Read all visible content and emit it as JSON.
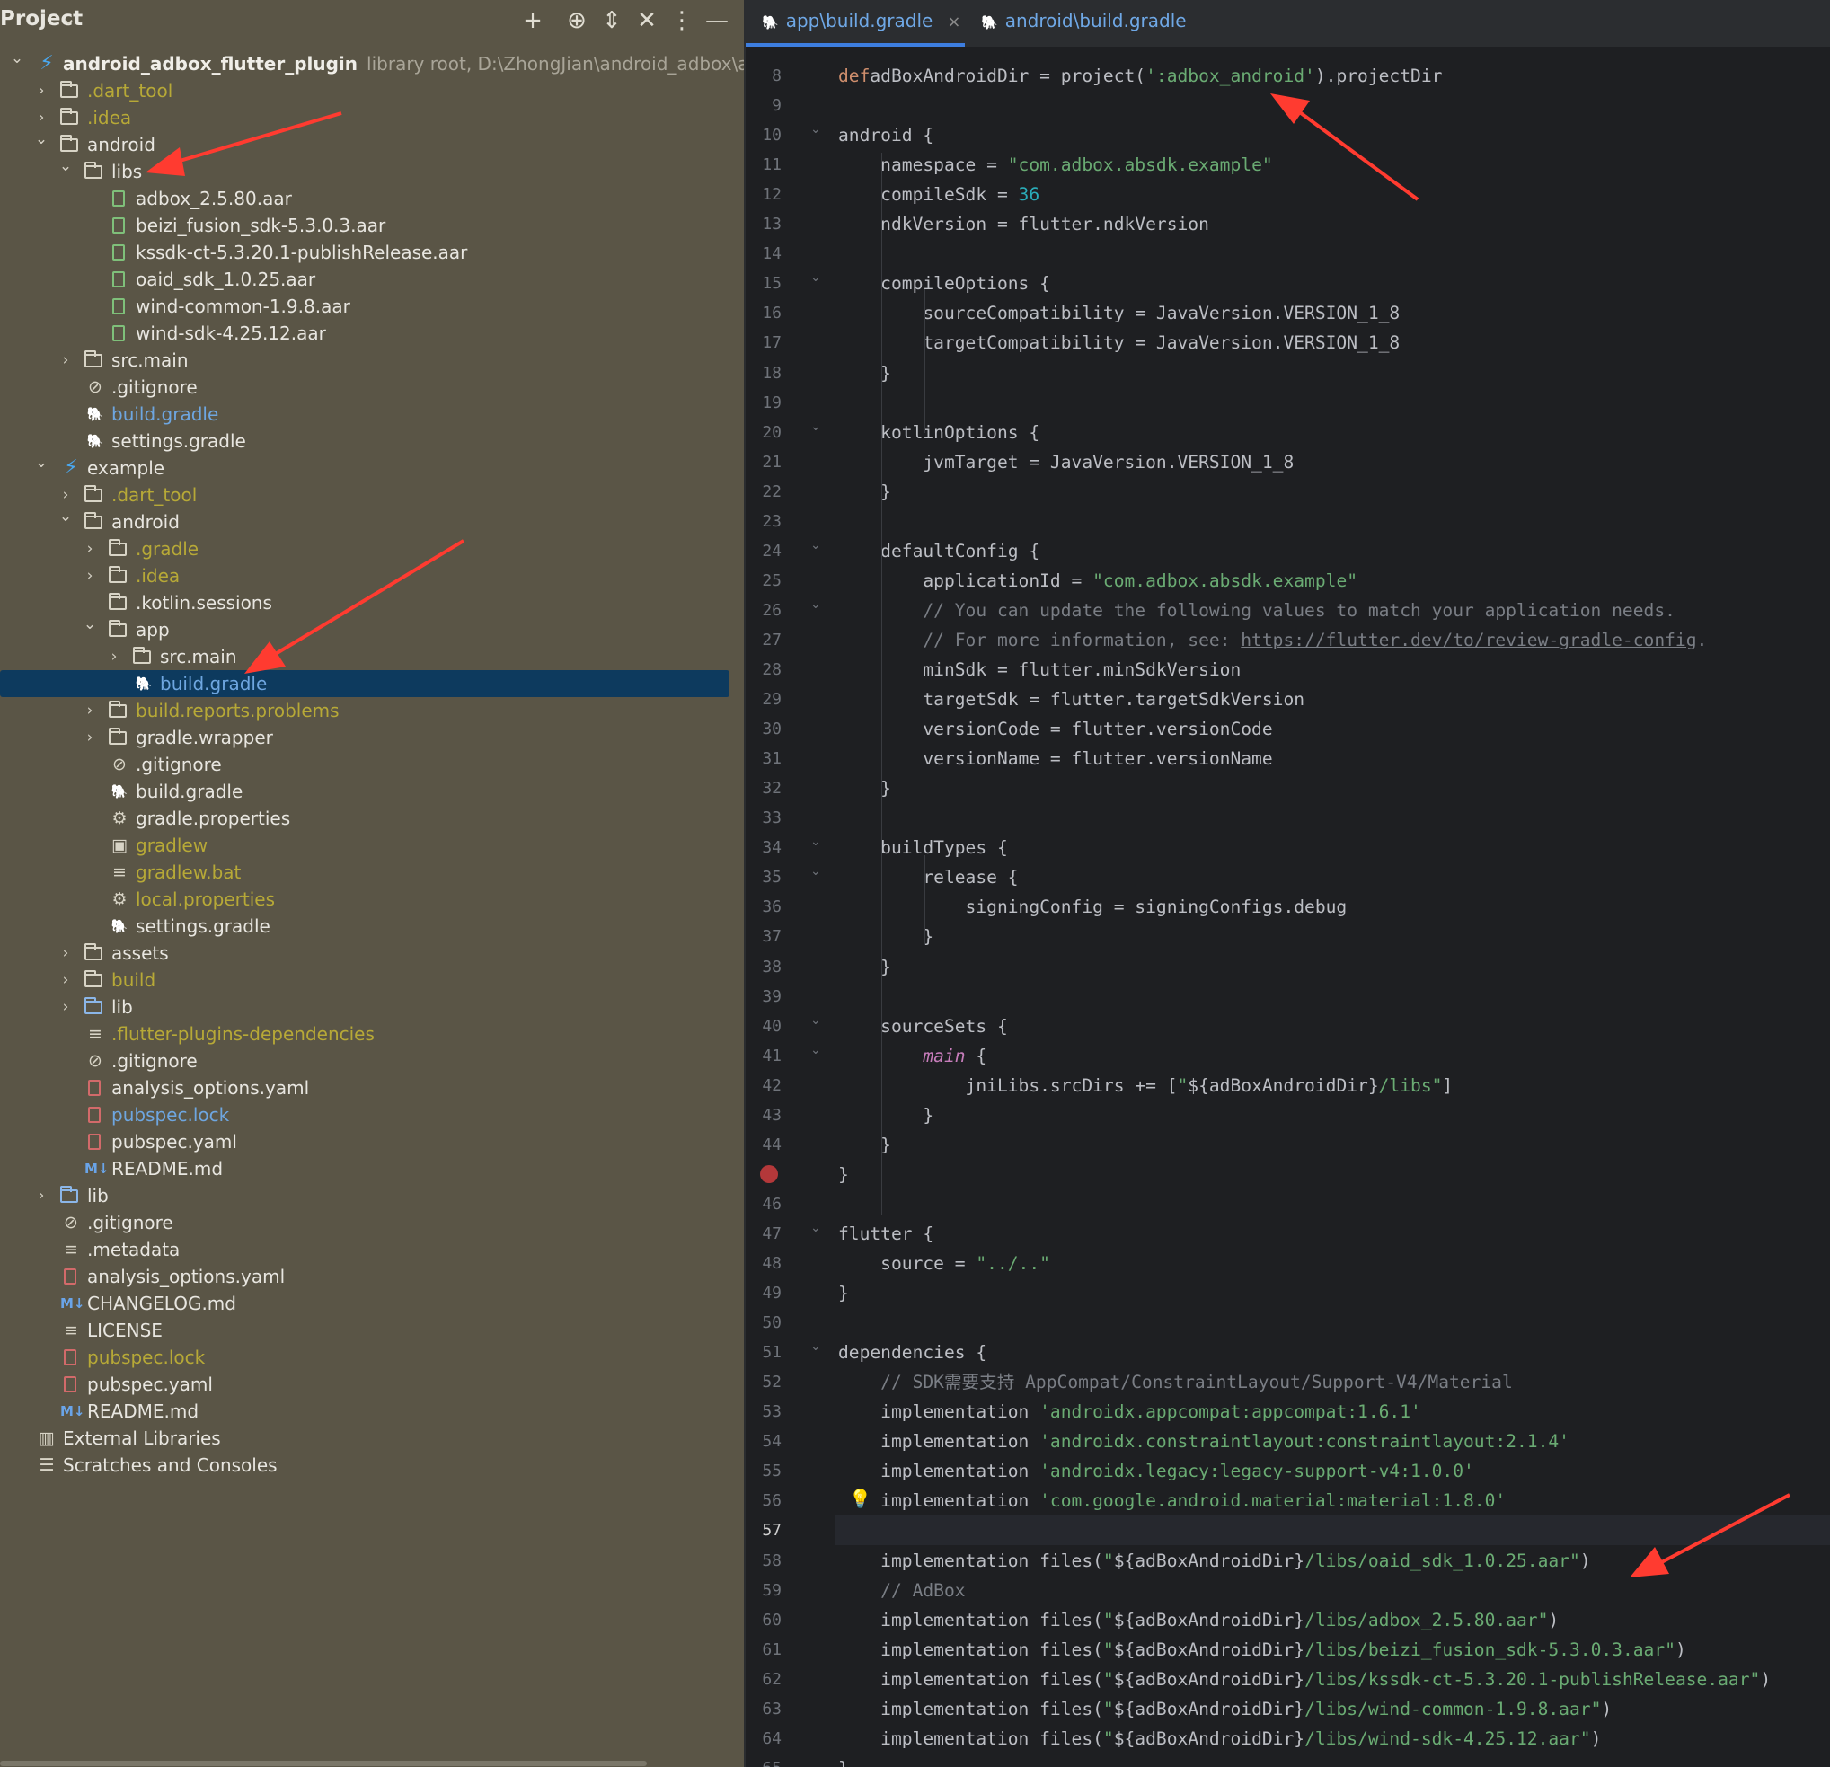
{
  "project_panel": {
    "title": "Project",
    "tree": [
      {
        "depth": 0,
        "toggle": "v",
        "icon": "flutter",
        "label": "android_adbox_flutter_plugin",
        "style": "bold",
        "meta": "library root,  D:\\ZhongJian\\android_adbox\\android_adbox_f"
      },
      {
        "depth": 1,
        "toggle": ">",
        "icon": "folder",
        "label": ".dart_tool",
        "style": "ignored"
      },
      {
        "depth": 1,
        "toggle": ">",
        "icon": "folder",
        "label": ".idea",
        "style": "ignored"
      },
      {
        "depth": 1,
        "toggle": "v",
        "icon": "folder",
        "label": "android",
        "style": ""
      },
      {
        "depth": 2,
        "toggle": "v",
        "icon": "folder",
        "label": "libs",
        "style": ""
      },
      {
        "depth": 3,
        "toggle": "",
        "icon": "file-green",
        "label": "adbox_2.5.80.aar",
        "style": ""
      },
      {
        "depth": 3,
        "toggle": "",
        "icon": "file-green",
        "label": "beizi_fusion_sdk-5.3.0.3.aar",
        "style": ""
      },
      {
        "depth": 3,
        "toggle": "",
        "icon": "file-green",
        "label": "kssdk-ct-5.3.20.1-publishRelease.aar",
        "style": ""
      },
      {
        "depth": 3,
        "toggle": "",
        "icon": "file-green",
        "label": "oaid_sdk_1.0.25.aar",
        "style": ""
      },
      {
        "depth": 3,
        "toggle": "",
        "icon": "file-green",
        "label": "wind-common-1.9.8.aar",
        "style": ""
      },
      {
        "depth": 3,
        "toggle": "",
        "icon": "file-green",
        "label": "wind-sdk-4.25.12.aar",
        "style": ""
      },
      {
        "depth": 2,
        "toggle": ">",
        "icon": "folder",
        "label": "src.main",
        "style": ""
      },
      {
        "depth": 2,
        "toggle": "",
        "icon": "gitignore",
        "label": ".gitignore",
        "style": ""
      },
      {
        "depth": 2,
        "toggle": "",
        "icon": "gradle",
        "label": "build.gradle",
        "style": "blue"
      },
      {
        "depth": 2,
        "toggle": "",
        "icon": "gradle",
        "label": "settings.gradle",
        "style": ""
      },
      {
        "depth": 1,
        "toggle": "v",
        "icon": "flutter",
        "label": "example",
        "style": ""
      },
      {
        "depth": 2,
        "toggle": ">",
        "icon": "folder",
        "label": ".dart_tool",
        "style": "ignored"
      },
      {
        "depth": 2,
        "toggle": "v",
        "icon": "folder",
        "label": "android",
        "style": ""
      },
      {
        "depth": 3,
        "toggle": ">",
        "icon": "folder",
        "label": ".gradle",
        "style": "ignored"
      },
      {
        "depth": 3,
        "toggle": ">",
        "icon": "folder",
        "label": ".idea",
        "style": "ignored"
      },
      {
        "depth": 3,
        "toggle": "",
        "icon": "folder",
        "label": ".kotlin.sessions",
        "style": ""
      },
      {
        "depth": 3,
        "toggle": "v",
        "icon": "folder",
        "label": "app",
        "style": ""
      },
      {
        "depth": 4,
        "toggle": ">",
        "icon": "folder",
        "label": "src.main",
        "style": ""
      },
      {
        "depth": 4,
        "toggle": "",
        "icon": "gradle",
        "label": "build.gradle",
        "style": "blue",
        "selected": true
      },
      {
        "depth": 3,
        "toggle": ">",
        "icon": "folder",
        "label": "build.reports.problems",
        "style": "ignored"
      },
      {
        "depth": 3,
        "toggle": ">",
        "icon": "folder",
        "label": "gradle.wrapper",
        "style": ""
      },
      {
        "depth": 3,
        "toggle": "",
        "icon": "gitignore",
        "label": ".gitignore",
        "style": ""
      },
      {
        "depth": 3,
        "toggle": "",
        "icon": "gradle",
        "label": "build.gradle",
        "style": ""
      },
      {
        "depth": 3,
        "toggle": "",
        "icon": "gear",
        "label": "gradle.properties",
        "style": ""
      },
      {
        "depth": 3,
        "toggle": "",
        "icon": "terminal",
        "label": "gradlew",
        "style": "ignored"
      },
      {
        "depth": 3,
        "toggle": "",
        "icon": "lines",
        "label": "gradlew.bat",
        "style": "ignored"
      },
      {
        "depth": 3,
        "toggle": "",
        "icon": "gear",
        "label": "local.properties",
        "style": "ignored"
      },
      {
        "depth": 3,
        "toggle": "",
        "icon": "gradle",
        "label": "settings.gradle",
        "style": ""
      },
      {
        "depth": 2,
        "toggle": ">",
        "icon": "folder",
        "label": "assets",
        "style": ""
      },
      {
        "depth": 2,
        "toggle": ">",
        "icon": "folder",
        "label": "build",
        "style": "ignored"
      },
      {
        "depth": 2,
        "toggle": ">",
        "icon": "folder-blue",
        "label": "lib",
        "style": ""
      },
      {
        "depth": 2,
        "toggle": "",
        "icon": "lines",
        "label": ".flutter-plugins-dependencies",
        "style": "ignored"
      },
      {
        "depth": 2,
        "toggle": "",
        "icon": "gitignore",
        "label": ".gitignore",
        "style": ""
      },
      {
        "depth": 2,
        "toggle": "",
        "icon": "file-red",
        "label": "analysis_options.yaml",
        "style": ""
      },
      {
        "depth": 2,
        "toggle": "",
        "icon": "file-red",
        "label": "pubspec.lock",
        "style": "blue"
      },
      {
        "depth": 2,
        "toggle": "",
        "icon": "file-red",
        "label": "pubspec.yaml",
        "style": ""
      },
      {
        "depth": 2,
        "toggle": "",
        "icon": "markdown",
        "label": "README.md",
        "style": ""
      },
      {
        "depth": 1,
        "toggle": ">",
        "icon": "folder-blue",
        "label": "lib",
        "style": ""
      },
      {
        "depth": 1,
        "toggle": "",
        "icon": "gitignore",
        "label": ".gitignore",
        "style": ""
      },
      {
        "depth": 1,
        "toggle": "",
        "icon": "lines",
        "label": ".metadata",
        "style": ""
      },
      {
        "depth": 1,
        "toggle": "",
        "icon": "file-red",
        "label": "analysis_options.yaml",
        "style": ""
      },
      {
        "depth": 1,
        "toggle": "",
        "icon": "markdown",
        "label": "CHANGELOG.md",
        "style": ""
      },
      {
        "depth": 1,
        "toggle": "",
        "icon": "lines",
        "label": "LICENSE",
        "style": ""
      },
      {
        "depth": 1,
        "toggle": "",
        "icon": "file-red",
        "label": "pubspec.lock",
        "style": "ignored"
      },
      {
        "depth": 1,
        "toggle": "",
        "icon": "file-red",
        "label": "pubspec.yaml",
        "style": ""
      },
      {
        "depth": 1,
        "toggle": "",
        "icon": "markdown",
        "label": "README.md",
        "style": ""
      },
      {
        "depth": 0,
        "toggle": "",
        "icon": "library",
        "label": "External Libraries",
        "style": ""
      },
      {
        "depth": 0,
        "toggle": "",
        "icon": "scratches",
        "label": "Scratches and Consoles",
        "style": ""
      }
    ]
  },
  "editor": {
    "tabs": [
      {
        "label": "app\\build.gradle",
        "active": true,
        "icon": "gradle-icon"
      },
      {
        "label": "android\\build.gradle",
        "active": false,
        "icon": "gradle-icon"
      }
    ],
    "current_line": 57,
    "lines": [
      {
        "n": 8,
        "fold": "",
        "segs": [
          [
            "kw",
            "def"
          ],
          [
            "",
            "adBoxAndroidDir = project("
          ],
          [
            "str",
            "':adbox_android'"
          ],
          [
            "",
            ").projectDir"
          ]
        ]
      },
      {
        "n": 9,
        "fold": "",
        "segs": []
      },
      {
        "n": 10,
        "fold": "v",
        "segs": [
          [
            "",
            "android {"
          ]
        ]
      },
      {
        "n": 11,
        "fold": "",
        "segs": [
          [
            "",
            "    namespace = "
          ],
          [
            "str",
            "\"com.adbox.absdk.example\""
          ]
        ]
      },
      {
        "n": 12,
        "fold": "",
        "segs": [
          [
            "",
            "    compileSdk = "
          ],
          [
            "num",
            "36"
          ]
        ]
      },
      {
        "n": 13,
        "fold": "",
        "segs": [
          [
            "",
            "    ndkVersion = flutter.ndkVersion"
          ]
        ]
      },
      {
        "n": 14,
        "fold": "",
        "segs": []
      },
      {
        "n": 15,
        "fold": "v",
        "segs": [
          [
            "",
            "    compileOptions {"
          ]
        ]
      },
      {
        "n": 16,
        "fold": "",
        "segs": [
          [
            "",
            "        sourceCompatibility = JavaVersion.VERSION_1_8"
          ]
        ]
      },
      {
        "n": 17,
        "fold": "",
        "segs": [
          [
            "",
            "        targetCompatibility = JavaVersion.VERSION_1_8"
          ]
        ]
      },
      {
        "n": 18,
        "fold": "",
        "segs": [
          [
            "",
            "    }"
          ]
        ]
      },
      {
        "n": 19,
        "fold": "",
        "segs": []
      },
      {
        "n": 20,
        "fold": "v",
        "segs": [
          [
            "",
            "    kotlinOptions {"
          ]
        ]
      },
      {
        "n": 21,
        "fold": "",
        "segs": [
          [
            "",
            "        jvmTarget = JavaVersion.VERSION_1_8"
          ]
        ]
      },
      {
        "n": 22,
        "fold": "",
        "segs": [
          [
            "",
            "    }"
          ]
        ]
      },
      {
        "n": 23,
        "fold": "",
        "segs": []
      },
      {
        "n": 24,
        "fold": "v",
        "segs": [
          [
            "",
            "    defaultConfig {"
          ]
        ]
      },
      {
        "n": 25,
        "fold": "",
        "segs": [
          [
            "",
            "        applicationId = "
          ],
          [
            "str",
            "\"com.adbox.absdk.example\""
          ]
        ]
      },
      {
        "n": 26,
        "fold": "v",
        "segs": [
          [
            "cmt",
            "        // You can update the following values to match your application needs."
          ]
        ]
      },
      {
        "n": 27,
        "fold": "",
        "segs": [
          [
            "cmt",
            "        // For more information, see: "
          ],
          [
            "url",
            "https://flutter.dev/to/review-gradle-config"
          ],
          [
            "cmt",
            "."
          ]
        ]
      },
      {
        "n": 28,
        "fold": "",
        "segs": [
          [
            "",
            "        minSdk = flutter.minSdkVersion"
          ]
        ]
      },
      {
        "n": 29,
        "fold": "",
        "segs": [
          [
            "",
            "        targetSdk = flutter.targetSdkVersion"
          ]
        ]
      },
      {
        "n": 30,
        "fold": "",
        "segs": [
          [
            "",
            "        versionCode = flutter.versionCode"
          ]
        ]
      },
      {
        "n": 31,
        "fold": "",
        "segs": [
          [
            "",
            "        versionName = flutter.versionName"
          ]
        ]
      },
      {
        "n": 32,
        "fold": "",
        "segs": [
          [
            "",
            "    }"
          ]
        ]
      },
      {
        "n": 33,
        "fold": "",
        "segs": []
      },
      {
        "n": 34,
        "fold": "v",
        "segs": [
          [
            "",
            "    buildTypes {"
          ]
        ]
      },
      {
        "n": 35,
        "fold": "v",
        "segs": [
          [
            "",
            "        release {"
          ]
        ]
      },
      {
        "n": 36,
        "fold": "",
        "segs": [
          [
            "",
            "            signingConfig = signingConfigs.debug"
          ]
        ]
      },
      {
        "n": 37,
        "fold": "",
        "segs": [
          [
            "",
            "        }"
          ]
        ]
      },
      {
        "n": 38,
        "fold": "",
        "segs": [
          [
            "",
            "    }"
          ]
        ]
      },
      {
        "n": 39,
        "fold": "",
        "segs": []
      },
      {
        "n": 40,
        "fold": "v",
        "segs": [
          [
            "",
            "    sourceSets {"
          ]
        ]
      },
      {
        "n": 41,
        "fold": "v",
        "segs": [
          [
            "",
            "        "
          ],
          [
            "it",
            "main"
          ],
          [
            "",
            " {"
          ]
        ]
      },
      {
        "n": 42,
        "fold": "",
        "segs": [
          [
            "",
            "            jniLibs.srcDirs += ["
          ],
          [
            "str",
            "\""
          ],
          [
            "interp",
            "${adBoxAndroidDir}"
          ],
          [
            "str",
            "/libs\""
          ],
          [
            "",
            "]"
          ]
        ]
      },
      {
        "n": 43,
        "fold": "",
        "segs": [
          [
            "",
            "        }"
          ]
        ]
      },
      {
        "n": 44,
        "fold": "",
        "segs": [
          [
            "",
            "    }"
          ]
        ]
      },
      {
        "n": 45,
        "fold": "",
        "bp": true,
        "segs": [
          [
            "",
            "}"
          ]
        ]
      },
      {
        "n": 46,
        "fold": "",
        "segs": []
      },
      {
        "n": 47,
        "fold": "v",
        "segs": [
          [
            "",
            "flutter {"
          ]
        ]
      },
      {
        "n": 48,
        "fold": "",
        "segs": [
          [
            "",
            "    source = "
          ],
          [
            "str",
            "\"../..\""
          ]
        ]
      },
      {
        "n": 49,
        "fold": "",
        "segs": [
          [
            "",
            "}"
          ]
        ]
      },
      {
        "n": 50,
        "fold": "",
        "segs": []
      },
      {
        "n": 51,
        "fold": "v",
        "segs": [
          [
            "",
            "dependencies {"
          ]
        ]
      },
      {
        "n": 52,
        "fold": "",
        "segs": [
          [
            "cmt",
            "    // SDK需要支持 AppCompat/ConstraintLayout/Support-V4/Material"
          ]
        ]
      },
      {
        "n": 53,
        "fold": "",
        "segs": [
          [
            "",
            "    implementation "
          ],
          [
            "str",
            "'androidx.appcompat:appcompat:1.6.1'"
          ]
        ]
      },
      {
        "n": 54,
        "fold": "",
        "segs": [
          [
            "",
            "    implementation "
          ],
          [
            "str",
            "'androidx.constraintlayout:constraintlayout:2.1.4'"
          ]
        ]
      },
      {
        "n": 55,
        "fold": "",
        "segs": [
          [
            "",
            "    implementation "
          ],
          [
            "str",
            "'androidx.legacy:legacy-support-v4:1.0.0'"
          ]
        ]
      },
      {
        "n": 56,
        "fold": "",
        "bulb": true,
        "segs": [
          [
            "",
            "    implementation "
          ],
          [
            "str",
            "'com.google.android.material:material:1.8.0'"
          ]
        ]
      },
      {
        "n": 57,
        "fold": "",
        "segs": []
      },
      {
        "n": 58,
        "fold": "",
        "segs": [
          [
            "",
            "    implementation files("
          ],
          [
            "str",
            "\""
          ],
          [
            "interp",
            "${adBoxAndroidDir}"
          ],
          [
            "str",
            "/libs/oaid_sdk_1.0.25.aar\""
          ],
          [
            "",
            ")"
          ]
        ]
      },
      {
        "n": 59,
        "fold": "",
        "segs": [
          [
            "cmt",
            "    // AdBox"
          ]
        ]
      },
      {
        "n": 60,
        "fold": "",
        "segs": [
          [
            "",
            "    implementation files("
          ],
          [
            "str",
            "\""
          ],
          [
            "interp",
            "${adBoxAndroidDir}"
          ],
          [
            "str",
            "/libs/adbox_2.5.80.aar\""
          ],
          [
            "",
            ")"
          ]
        ]
      },
      {
        "n": 61,
        "fold": "",
        "segs": [
          [
            "",
            "    implementation files("
          ],
          [
            "str",
            "\""
          ],
          [
            "interp",
            "${adBoxAndroidDir}"
          ],
          [
            "str",
            "/libs/beizi_fusion_sdk-5.3.0.3.aar\""
          ],
          [
            "",
            ")"
          ]
        ]
      },
      {
        "n": 62,
        "fold": "",
        "segs": [
          [
            "",
            "    implementation files("
          ],
          [
            "str",
            "\""
          ],
          [
            "interp",
            "${adBoxAndroidDir}"
          ],
          [
            "str",
            "/libs/kssdk-ct-5.3.20.1-publishRelease.aar\""
          ],
          [
            "",
            ")"
          ]
        ]
      },
      {
        "n": 63,
        "fold": "",
        "segs": [
          [
            "",
            "    implementation files("
          ],
          [
            "str",
            "\""
          ],
          [
            "interp",
            "${adBoxAndroidDir}"
          ],
          [
            "str",
            "/libs/wind-common-1.9.8.aar\""
          ],
          [
            "",
            ")"
          ]
        ]
      },
      {
        "n": 64,
        "fold": "",
        "segs": [
          [
            "",
            "    implementation files("
          ],
          [
            "str",
            "\""
          ],
          [
            "interp",
            "${adBoxAndroidDir}"
          ],
          [
            "str",
            "/libs/wind-sdk-4.25.12.aar\""
          ],
          [
            "",
            ")"
          ]
        ]
      },
      {
        "n": 65,
        "fold": "",
        "segs": [
          [
            "",
            "}"
          ]
        ]
      }
    ]
  },
  "colors": {
    "annotation_arrow": "#ff3b30",
    "selection": "#0d3a5e",
    "project_bg": "#5a5546",
    "editor_bg": "#1e1f22"
  }
}
